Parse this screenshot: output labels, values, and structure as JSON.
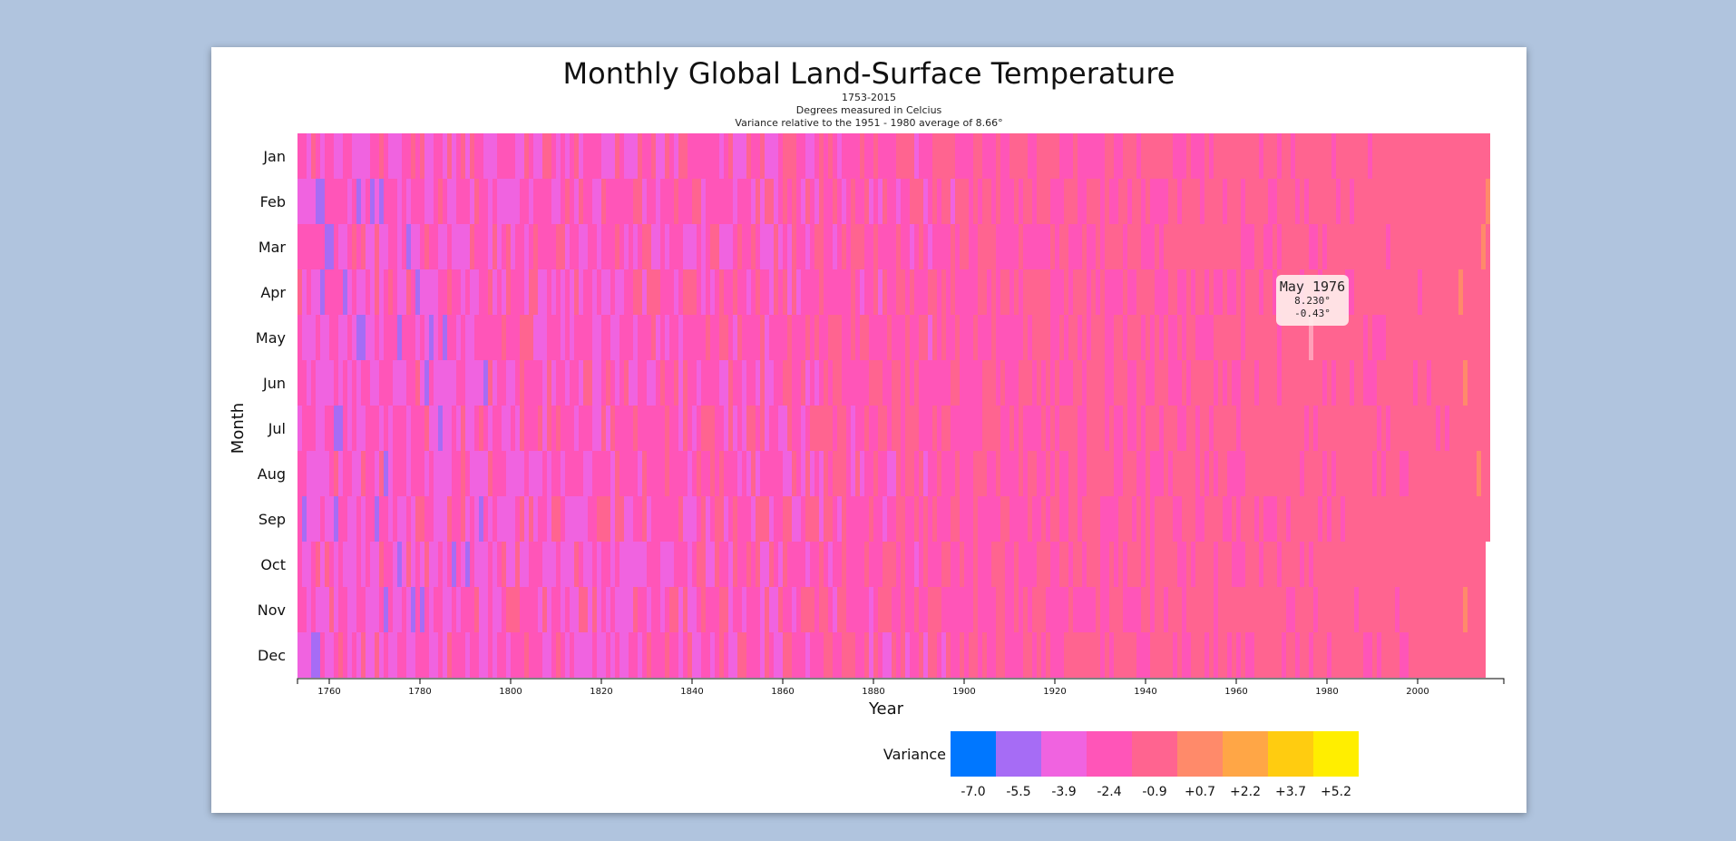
{
  "chart_data": {
    "type": "heatmap",
    "title": "Monthly Global Land-Surface Temperature",
    "subtitle_lines": [
      "1753-2015",
      "Degrees measured in Celcius",
      "Variance relative to the 1951 - 1980 average of 8.66°"
    ],
    "xlabel": "Year",
    "ylabel": "Month",
    "x_range": [
      1753,
      2015
    ],
    "x_ticks": [
      1760,
      1780,
      1800,
      1820,
      1840,
      1860,
      1880,
      1900,
      1920,
      1940,
      1960,
      1980,
      2000
    ],
    "months": [
      "Jan",
      "Feb",
      "Mar",
      "Apr",
      "May",
      "Jun",
      "Jul",
      "Aug",
      "Sep",
      "Oct",
      "Nov",
      "Dec"
    ],
    "base_temperature": 8.66,
    "last_data_point": {
      "year": 2015,
      "month": "Sep"
    },
    "legend": {
      "label": "Variance",
      "values": [
        "-7.0",
        "-5.5",
        "-3.9",
        "-2.4",
        "-0.9",
        "+0.7",
        "+2.2",
        "+3.7",
        "+5.2"
      ],
      "colors": [
        "#0077ff",
        "#a66cf5",
        "#f063e0",
        "#ff55b8",
        "#ff6490",
        "#ff8a6a",
        "#ffa646",
        "#ffcc10",
        "#ffee00"
      ]
    },
    "highlight": {
      "label": "May 1976",
      "temperature": "8.230°",
      "variance": "-0.43°"
    }
  }
}
